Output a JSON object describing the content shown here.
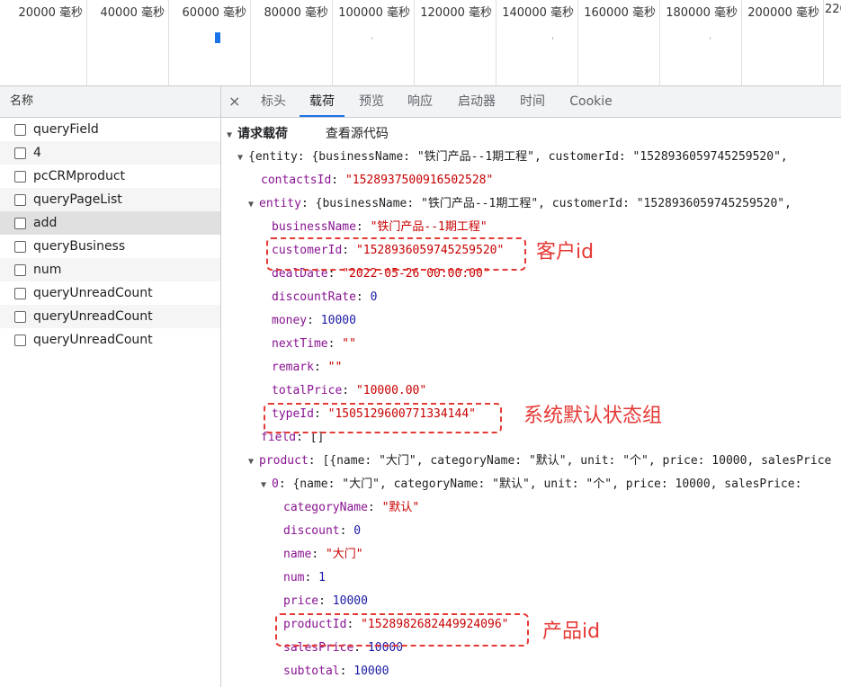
{
  "timeline": {
    "ticks": [
      "20000 毫秒",
      "40000 毫秒",
      "60000 毫秒",
      "80000 毫秒",
      "100000 毫秒",
      "120000 毫秒",
      "140000 毫秒",
      "160000 毫秒",
      "180000 毫秒",
      "200000 毫秒",
      "220"
    ]
  },
  "requests": {
    "header": "名称",
    "items": [
      "queryField",
      "4",
      "pcCRMproduct",
      "queryPageList",
      "add",
      "queryBusiness",
      "num",
      "queryUnreadCount",
      "queryUnreadCount",
      "queryUnreadCount"
    ]
  },
  "tabs": {
    "close": "×",
    "items": [
      "标头",
      "载荷",
      "预览",
      "响应",
      "启动器",
      "时间",
      "Cookie"
    ],
    "active": "载荷"
  },
  "payload": {
    "section_title": "请求载荷",
    "view_source": "查看源代码",
    "root_summary": "{entity: {businessName: \"铁门产品--1期工程\", customerId: \"1528936059745259520\",",
    "contactsId_key": "contactsId",
    "contactsId_val": "\"1528937500916502528\"",
    "entity_key": "entity",
    "entity_summary": "{businessName: \"铁门产品--1期工程\", customerId: \"1528936059745259520\",",
    "businessName_key": "businessName",
    "businessName_val": "\"铁门产品--1期工程\"",
    "customerId_key": "customerId",
    "customerId_val": "\"1528936059745259520\"",
    "dealDate_key": "dealDate",
    "dealDate_val": "\"2022-05-26 00:00:00\"",
    "discountRate_key": "discountRate",
    "discountRate_val": "0",
    "money_key": "money",
    "money_val": "10000",
    "nextTime_key": "nextTime",
    "nextTime_val": "\"\"",
    "remark_key": "remark",
    "remark_val": "\"\"",
    "totalPrice_key": "totalPrice",
    "totalPrice_val": "\"10000.00\"",
    "typeId_key": "typeId",
    "typeId_val": "\"1505129600771334144\"",
    "field_key": "field",
    "field_val": "[]",
    "product_key": "product",
    "product_summary": "[{name: \"大门\", categoryName: \"默认\", unit: \"个\", price: 10000, salesPrice",
    "item0_key": "0",
    "item0_summary": "{name: \"大门\", categoryName: \"默认\", unit: \"个\", price: 10000, salesPrice:",
    "categoryName_key": "categoryName",
    "categoryName_val": "\"默认\"",
    "discount_key": "discount",
    "discount_val": "0",
    "name_key": "name",
    "name_val": "\"大门\"",
    "num_key": "num",
    "num_val": "1",
    "price_key": "price",
    "price_val": "10000",
    "productId_key": "productId",
    "productId_val": "\"1528982682449924096\"",
    "salesPrice_key": "salesPrice",
    "salesPrice_val": "10000",
    "subtotal_key": "subtotal",
    "subtotal_val": "10000"
  },
  "annotations": {
    "customer": "客户id",
    "type": "系统默认状态组",
    "product": "产品id"
  },
  "colors": {
    "annotation": "#e53935",
    "key": "#881391",
    "string": "#c80000",
    "number": "#1a1aa6",
    "accent": "#1a73e8"
  }
}
